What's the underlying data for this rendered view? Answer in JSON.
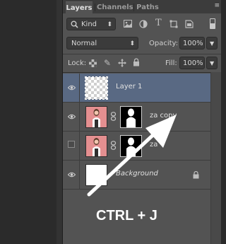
{
  "tabs": [
    {
      "label": "Layers",
      "active": true
    },
    {
      "label": "Channels",
      "active": false
    },
    {
      "label": "Paths",
      "active": false
    }
  ],
  "panel_menu_icon": "≡",
  "filter": {
    "kind_label": "Kind"
  },
  "blend": {
    "mode": "Normal",
    "opacity_label": "Opacity:",
    "opacity_value": "100%"
  },
  "lock": {
    "label": "Lock:",
    "fill_label": "Fill:",
    "fill_value": "100%"
  },
  "layers": [
    {
      "name": "Layer 1",
      "visible": true,
      "selected": true,
      "thumb": "transparent"
    },
    {
      "name": "za copy",
      "visible": true,
      "selected": false,
      "thumb": "photo",
      "mask": true
    },
    {
      "name": "za",
      "visible": false,
      "selected": false,
      "thumb": "photo",
      "mask": true
    },
    {
      "name": "Background",
      "visible": true,
      "selected": false,
      "thumb": "white",
      "locked": true
    }
  ],
  "caption": "CTRL + J",
  "colors": {
    "selected_layer": "#596983",
    "panel": "#535353",
    "photo_bg": "#e48f90"
  }
}
